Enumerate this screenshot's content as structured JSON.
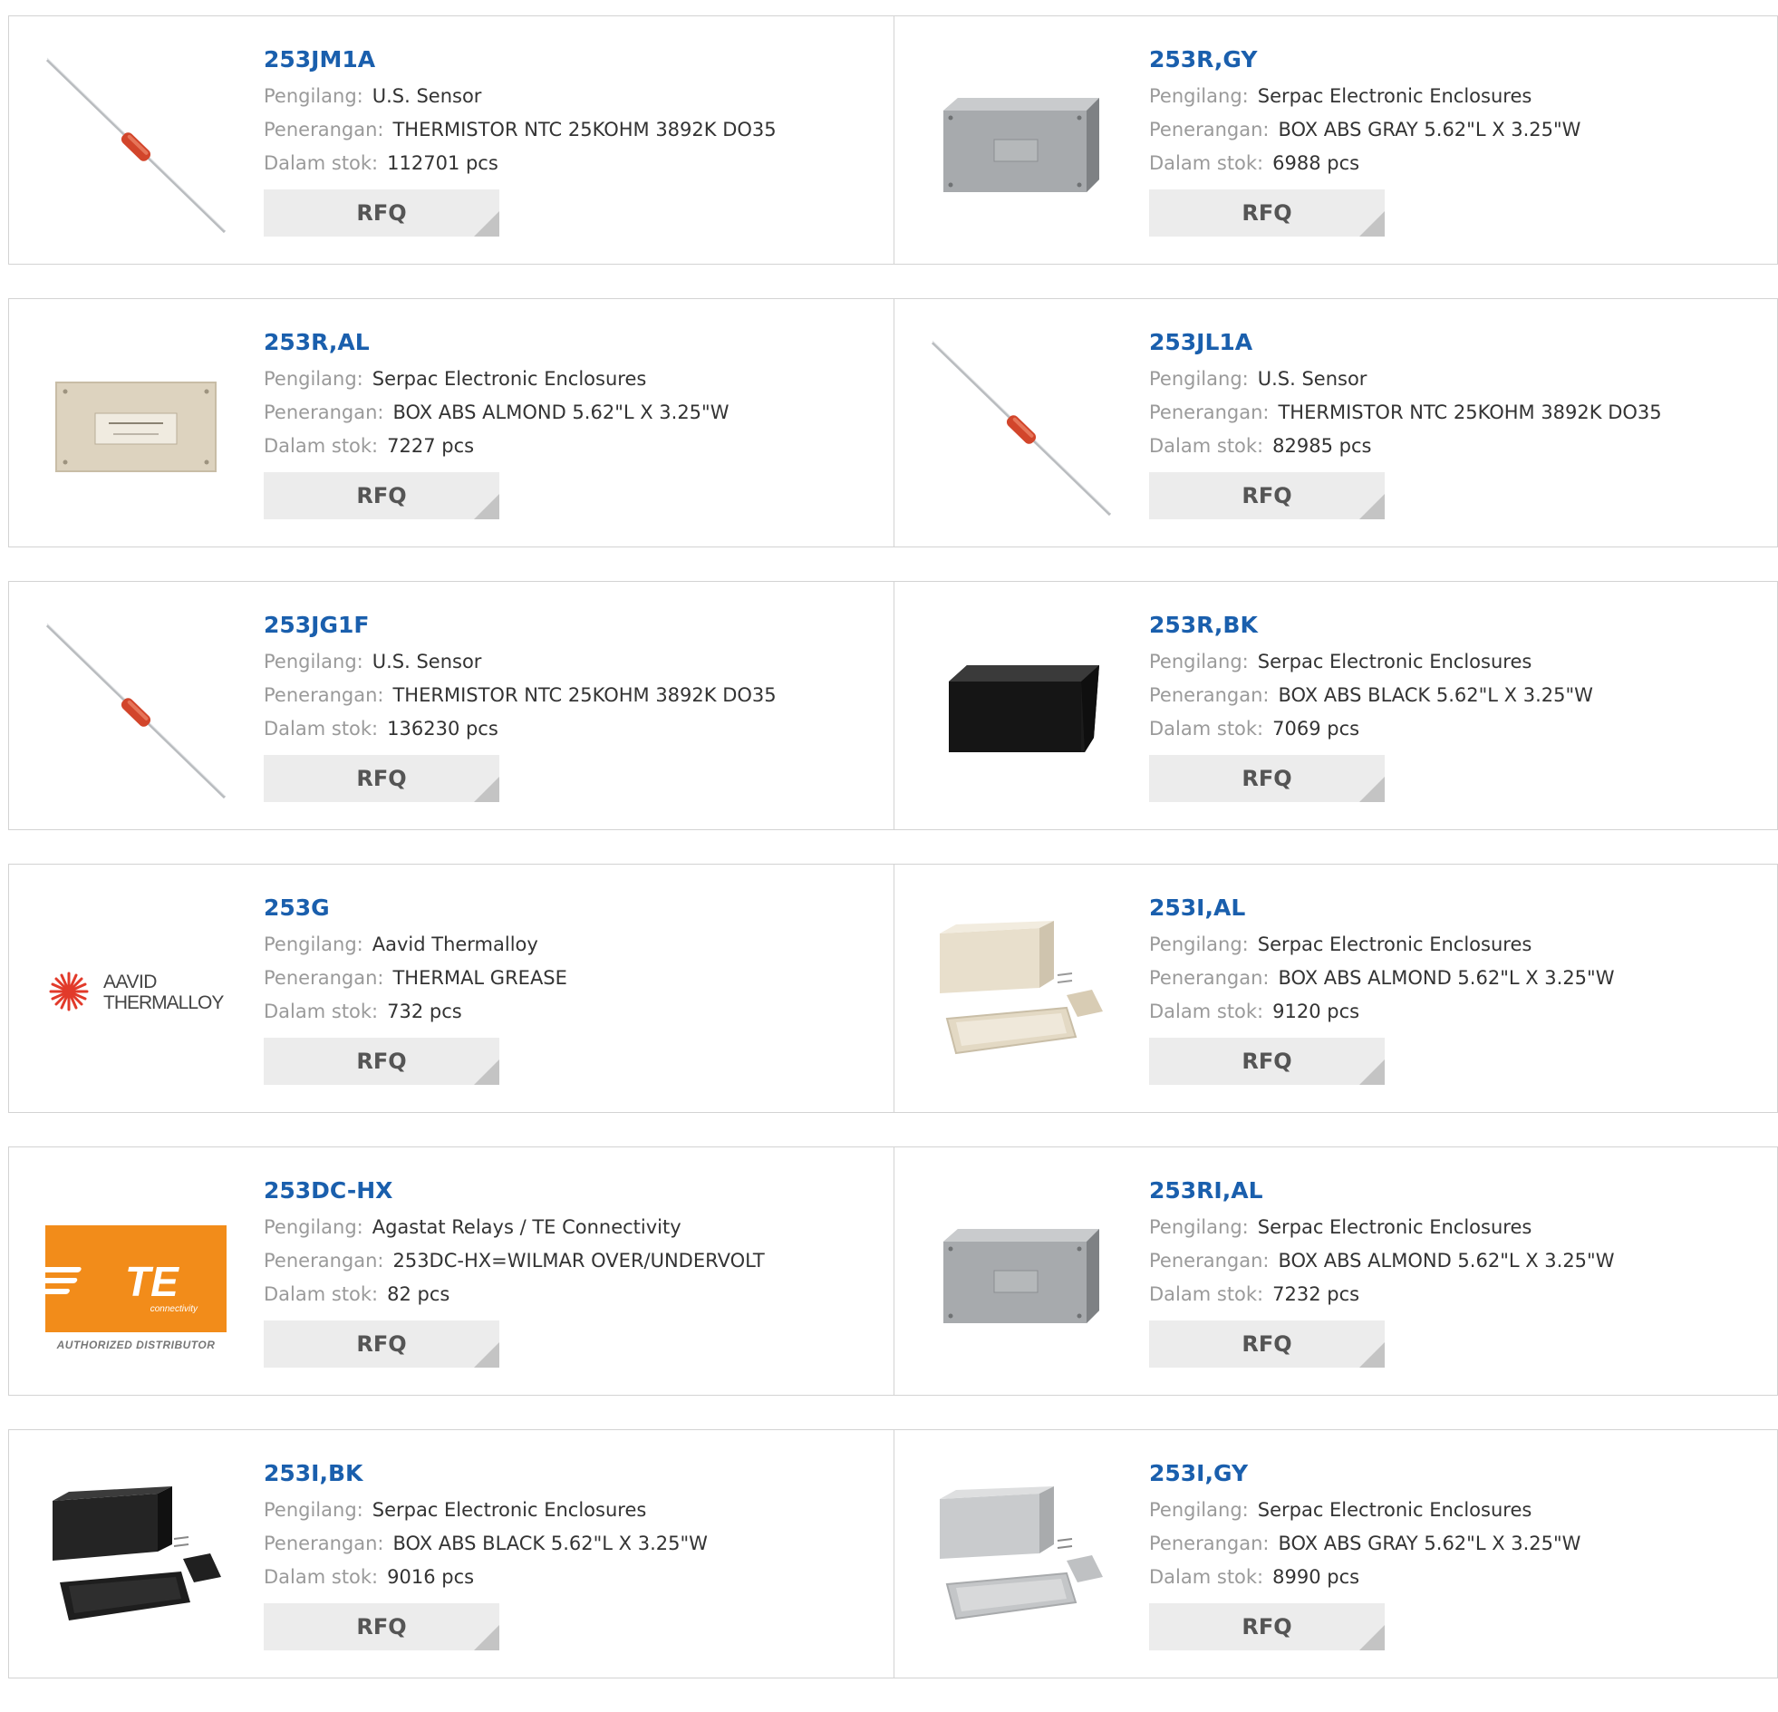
{
  "labels": {
    "manufacturer": "Pengilang:",
    "description": "Penerangan:",
    "stock": "Dalam stok:",
    "rfq": "RFQ"
  },
  "brands": {
    "aavid_line1": "AAVID",
    "aavid_line2": "THERMALLOY",
    "te_logo": "TE",
    "te_sub": "connectivity",
    "te_authorized": "AUTHORIZED DISTRIBUTOR"
  },
  "products": [
    {
      "part": "253JM1A",
      "manufacturer": "U.S. Sensor",
      "description": "THERMISTOR NTC 25KOHM 3892K DO35",
      "stock": "112701 pcs",
      "image": "thermistor-image"
    },
    {
      "part": "253R,GY",
      "manufacturer": "Serpac Electronic Enclosures",
      "description": "BOX ABS GRAY 5.62\"L X 3.25\"W",
      "stock": "6988 pcs",
      "image": "gray-box-image"
    },
    {
      "part": "253R,AL",
      "manufacturer": "Serpac Electronic Enclosures",
      "description": "BOX ABS ALMOND 5.62\"L X 3.25\"W",
      "stock": "7227 pcs",
      "image": "almond-box-image"
    },
    {
      "part": "253JL1A",
      "manufacturer": "U.S. Sensor",
      "description": "THERMISTOR NTC 25KOHM 3892K DO35",
      "stock": "82985 pcs",
      "image": "thermistor-image"
    },
    {
      "part": "253JG1F",
      "manufacturer": "U.S. Sensor",
      "description": "THERMISTOR NTC 25KOHM 3892K DO35",
      "stock": "136230 pcs",
      "image": "thermistor-image"
    },
    {
      "part": "253R,BK",
      "manufacturer": "Serpac Electronic Enclosures",
      "description": "BOX ABS BLACK 5.62\"L X 3.25\"W",
      "stock": "7069 pcs",
      "image": "black-box-image"
    },
    {
      "part": "253G",
      "manufacturer": "Aavid Thermalloy",
      "description": "THERMAL GREASE",
      "stock": "732 pcs",
      "image": "aavid-thermalloy-logo"
    },
    {
      "part": "253I,AL",
      "manufacturer": "Serpac Electronic Enclosures",
      "description": "BOX ABS ALMOND 5.62\"L X 3.25\"W",
      "stock": "9120 pcs",
      "image": "open-almond-box-image"
    },
    {
      "part": "253DC-HX",
      "manufacturer": "Agastat Relays / TE Connectivity",
      "description": "253DC-HX=WILMAR OVER/UNDERVOLT",
      "stock": "82 pcs",
      "image": "te-connectivity-logo"
    },
    {
      "part": "253RI,AL",
      "manufacturer": "Serpac Electronic Enclosures",
      "description": "BOX ABS ALMOND 5.62\"L X 3.25\"W",
      "stock": "7232 pcs",
      "image": "gray-box-image"
    },
    {
      "part": "253I,BK",
      "manufacturer": "Serpac Electronic Enclosures",
      "description": "BOX ABS BLACK 5.62\"L X 3.25\"W",
      "stock": "9016 pcs",
      "image": "open-black-box-image"
    },
    {
      "part": "253I,GY",
      "manufacturer": "Serpac Electronic Enclosures",
      "description": "BOX ABS GRAY 5.62\"L X 3.25\"W",
      "stock": "8990 pcs",
      "image": "open-gray-box-image"
    }
  ]
}
